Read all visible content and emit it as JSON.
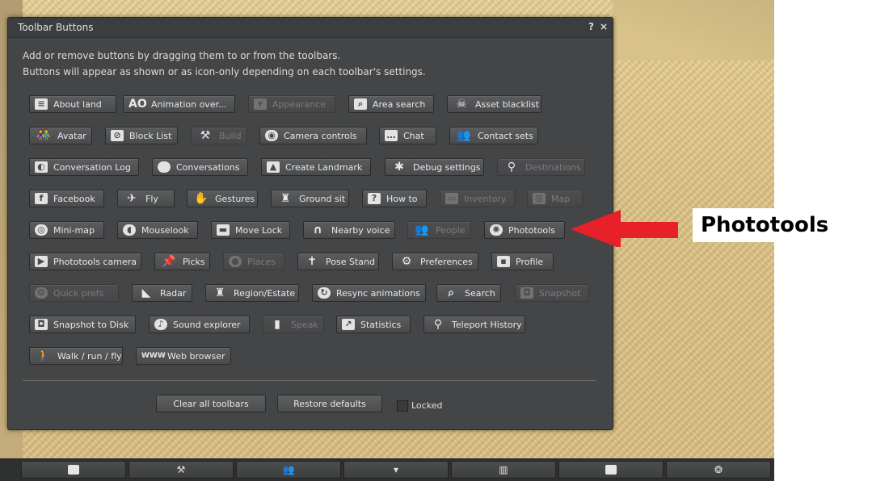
{
  "floater": {
    "title": "Toolbar Buttons",
    "help_glyph": "?",
    "close_glyph": "×",
    "description_line1": "Add or remove buttons by dragging them to or from the toolbars.",
    "description_line2": "Buttons will appear as shown or as icon-only depending on each toolbar's settings."
  },
  "buttons": {
    "about_land": {
      "label": "About land",
      "icon": "about-land-icon",
      "enabled": true
    },
    "animation_over": {
      "label": "Animation over...",
      "icon": "ao-icon",
      "icon_text": "AO",
      "enabled": true
    },
    "appearance": {
      "label": "Appearance",
      "icon": "shirt-icon",
      "enabled": false
    },
    "area_search": {
      "label": "Area search",
      "icon": "area-search-icon",
      "enabled": true
    },
    "asset_blacklist": {
      "label": "Asset blacklist",
      "icon": "skull-icon",
      "enabled": true
    },
    "avatar": {
      "label": "Avatar",
      "icon": "avatar-icon",
      "enabled": true
    },
    "block_list": {
      "label": "Block List",
      "icon": "block-list-icon",
      "enabled": true
    },
    "build": {
      "label": "Build",
      "icon": "hammer-icon",
      "enabled": false
    },
    "camera_controls": {
      "label": "Camera controls",
      "icon": "eye-icon",
      "enabled": true
    },
    "chat": {
      "label": "Chat",
      "icon": "chat-icon",
      "enabled": true
    },
    "contact_sets": {
      "label": "Contact sets",
      "icon": "contacts-icon",
      "enabled": true
    },
    "conversation_log": {
      "label": "Conversation Log",
      "icon": "conversation-log-icon",
      "enabled": true
    },
    "conversations": {
      "label": "Conversations",
      "icon": "speech-bubble-icon",
      "enabled": true
    },
    "create_landmark": {
      "label": "Create Landmark",
      "icon": "landmark-icon",
      "enabled": true
    },
    "debug_settings": {
      "label": "Debug settings",
      "icon": "bug-icon",
      "enabled": true
    },
    "destinations": {
      "label": "Destinations",
      "icon": "map-pin-icon",
      "enabled": false
    },
    "facebook": {
      "label": "Facebook",
      "icon": "facebook-icon",
      "icon_text": "f",
      "enabled": true
    },
    "fly": {
      "label": "Fly",
      "icon": "fly-icon",
      "enabled": true
    },
    "gestures": {
      "label": "Gestures",
      "icon": "hand-icon",
      "enabled": true
    },
    "ground_sit": {
      "label": "Ground sit",
      "icon": "ground-sit-icon",
      "enabled": true
    },
    "how_to": {
      "label": "How to",
      "icon": "question-icon",
      "icon_text": "?",
      "enabled": true
    },
    "inventory": {
      "label": "Inventory",
      "icon": "inventory-icon",
      "enabled": false
    },
    "map": {
      "label": "Map",
      "icon": "map-icon",
      "enabled": false
    },
    "mini_map": {
      "label": "Mini-map",
      "icon": "radar-circle-icon",
      "enabled": true
    },
    "mouselook": {
      "label": "Mouselook",
      "icon": "mouse-icon",
      "enabled": true
    },
    "move_lock": {
      "label": "Move Lock",
      "icon": "lock-icon",
      "enabled": true
    },
    "nearby_voice": {
      "label": "Nearby voice",
      "icon": "headphones-icon",
      "enabled": true
    },
    "people": {
      "label": "People",
      "icon": "people-icon",
      "enabled": false
    },
    "phototools": {
      "label": "Phototools",
      "icon": "aperture-icon",
      "enabled": true
    },
    "phototools_camera": {
      "label": "Phototools camera",
      "icon": "video-camera-icon",
      "enabled": true
    },
    "picks": {
      "label": "Picks",
      "icon": "pin-icon",
      "enabled": true
    },
    "places": {
      "label": "Places",
      "icon": "globe-icon",
      "enabled": false
    },
    "pose_stand": {
      "label": "Pose Stand",
      "icon": "pose-stand-icon",
      "enabled": true
    },
    "preferences": {
      "label": "Preferences",
      "icon": "gear-icon",
      "enabled": true
    },
    "profile": {
      "label": "Profile",
      "icon": "profile-card-icon",
      "enabled": true
    },
    "quick_prefs": {
      "label": "Quick prefs",
      "icon": "quick-prefs-icon",
      "enabled": false
    },
    "radar": {
      "label": "Radar",
      "icon": "radar-icon",
      "enabled": true
    },
    "region_estate": {
      "label": "Region/Estate",
      "icon": "castle-icon",
      "enabled": true
    },
    "resync_animations": {
      "label": "Resync animations",
      "icon": "resync-icon",
      "enabled": true
    },
    "search": {
      "label": "Search",
      "icon": "search-icon",
      "enabled": true
    },
    "snapshot": {
      "label": "Snapshot",
      "icon": "camera-icon",
      "enabled": false
    },
    "snapshot_to_disk": {
      "label": "Snapshot to Disk",
      "icon": "camera-disk-icon",
      "enabled": true
    },
    "sound_explorer": {
      "label": "Sound explorer",
      "icon": "sound-search-icon",
      "enabled": true
    },
    "speak": {
      "label": "Speak",
      "icon": "microphone-icon",
      "enabled": false
    },
    "statistics": {
      "label": "Statistics",
      "icon": "chart-icon",
      "enabled": true
    },
    "teleport_history": {
      "label": "Teleport History",
      "icon": "teleport-icon",
      "enabled": true
    },
    "walk_run_fly": {
      "label": "Walk / run / fly",
      "icon": "walk-icon",
      "enabled": true
    },
    "web_browser": {
      "label": "Web browser",
      "icon": "www-icon",
      "icon_text": "WWW",
      "enabled": true
    }
  },
  "footer": {
    "clear_all": "Clear all toolbars",
    "restore_defaults": "Restore defaults",
    "locked_label": "Locked",
    "locked_checked": false
  },
  "annotation": {
    "callout_text": "Phototools",
    "arrow_color": "#e8202a"
  },
  "bottom_toolbar": {
    "icons": [
      "camera-icon",
      "hammer-icon",
      "people-icon",
      "shirt-icon",
      "map-icon",
      "inventory-icon",
      "quick-prefs-icon"
    ]
  }
}
